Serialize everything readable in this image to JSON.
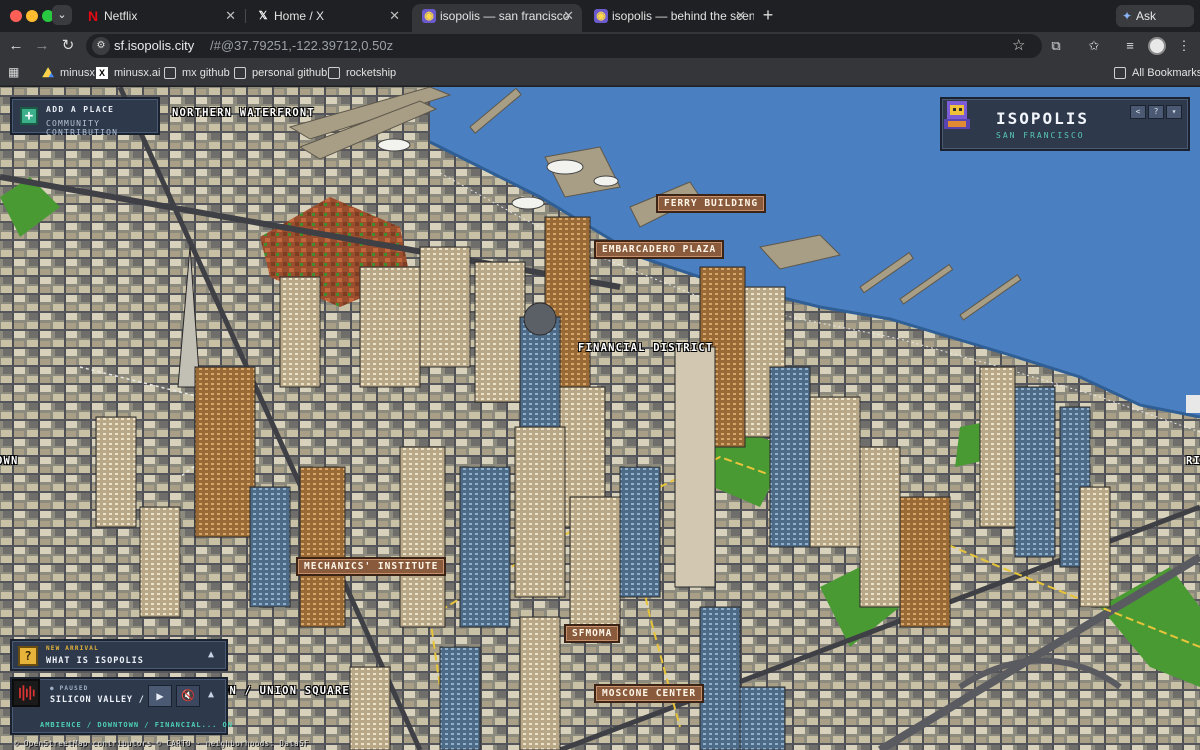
{
  "browser": {
    "tabs": [
      {
        "title": "Netflix",
        "favicon": "netflix-icon",
        "active": false
      },
      {
        "title": "Home / X",
        "favicon": "x-icon",
        "active": false
      },
      {
        "title": "isopolis — san francisco",
        "favicon": "isopolis-icon",
        "active": true
      },
      {
        "title": "isopolis — behind the scenes",
        "favicon": "isopolis-icon",
        "active": false
      }
    ],
    "ask_gemini": "Ask Gemini",
    "url_host": "sf.isopolis.city",
    "url_path": "/#@37.79251,-122.39712,0.50z",
    "bookmarks": [
      {
        "label": "minusx",
        "icon": "drive-icon"
      },
      {
        "label": "minusx.ai",
        "icon": "x-icon"
      },
      {
        "label": "mx github",
        "icon": "folder-icon"
      },
      {
        "label": "personal github",
        "icon": "folder-icon"
      },
      {
        "label": "rocketship",
        "icon": "folder-icon"
      }
    ],
    "all_bookmarks": "All Bookmarks"
  },
  "map": {
    "add_place": {
      "title": "ADD A PLACE",
      "subtitle": "COMMUNITY CONTRIBUTION"
    },
    "brand": {
      "title": "ISOPOLIS",
      "subtitle": "SAN FRANCISCO"
    },
    "neighborhoods": {
      "northern_waterfront": "NORTHERN WATERFRONT",
      "financial_district": "FINANCIAL DISTRICT",
      "union_square": "WN / UNION SQUARE",
      "left_edge": "OWN",
      "right_edge": "RI"
    },
    "places": {
      "ferry_building": "FERRY BUILDING",
      "embarcadero_plaza": "EMBARCADERO PLAZA",
      "mechanics_institute": "MECHANICS' INSTITUTE",
      "sfmoma": "SFMOMA",
      "moscone_center": "MOSCONE CENTER"
    },
    "arrival": {
      "tag": "NEW ARRIVAL",
      "title": "WHAT IS ISOPOLIS"
    },
    "player": {
      "status": "PAUSED",
      "title": "SILICON VALLEY / THE...",
      "tags": "AMBIENCE / DOWNTOWN / FINANCIAL... ON"
    },
    "attribution": "© OpenStreetMap contributors © CARTO · neighborhoods: DataSF"
  }
}
